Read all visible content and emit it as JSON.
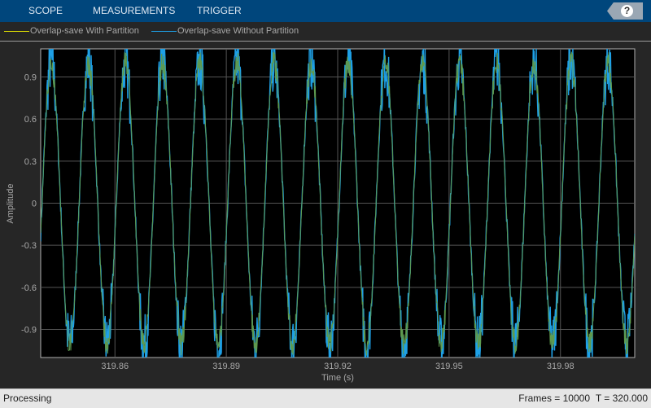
{
  "toolbar": {
    "tabs": [
      "SCOPE",
      "MEASUREMENTS",
      "TRIGGER"
    ],
    "help_label": "?"
  },
  "legend": [
    {
      "label": "Overlap-save With Partition",
      "color": "#e6e600"
    },
    {
      "label": "Overlap-save Without Partition",
      "color": "#1ea0e6"
    }
  ],
  "status": {
    "left": "Processing",
    "frames": "Frames = 10000",
    "time": "T = 320.000"
  },
  "chart_data": {
    "type": "line",
    "xlabel": "Time (s)",
    "ylabel": "Amplitude",
    "xlim": [
      319.84,
      320.0
    ],
    "ylim": [
      -1.1,
      1.1
    ],
    "xticks": [
      319.86,
      319.89,
      319.92,
      319.95,
      319.98
    ],
    "xtick_labels": [
      "319.86",
      "319.89",
      "319.92",
      "319.95",
      "319.98"
    ],
    "yticks": [
      0.9,
      0.6,
      0.3,
      0,
      -0.3,
      -0.6,
      -0.9
    ],
    "ytick_labels": [
      "0.9",
      "0.6",
      "0.3",
      "0",
      "-0.3",
      "-0.6",
      "-0.9"
    ],
    "grid": true,
    "series": [
      {
        "name": "Overlap-save With Partition",
        "color": "#5e9a4e",
        "frequency_hz": 100,
        "amplitude": 1.0,
        "peak_time": 319.84285,
        "noise": 0.04
      },
      {
        "name": "Overlap-save Without Partition",
        "color": "#1ea0e6",
        "frequency_hz": 100,
        "amplitude": 1.0,
        "peak_time": 319.84285,
        "noise": 0.09
      }
    ]
  }
}
